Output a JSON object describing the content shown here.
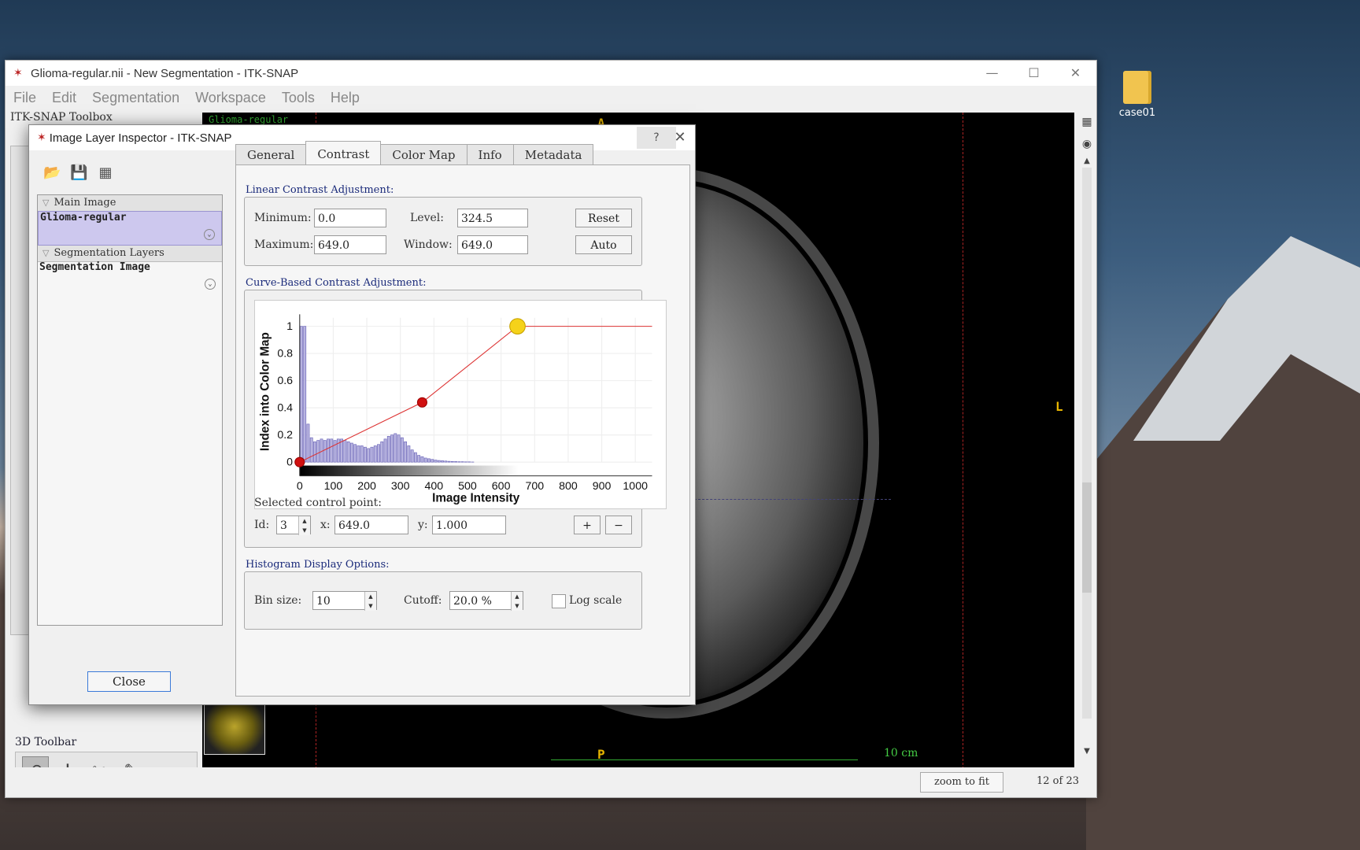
{
  "desktop": {
    "folder_label": "case01"
  },
  "window": {
    "title": "Glioma-regular.nii - New Segmentation - ITK-SNAP",
    "controls": [
      "—",
      "☐",
      "✕"
    ]
  },
  "menu": [
    "File",
    "Edit",
    "Segmentation",
    "Workspace",
    "Tools",
    "Help"
  ],
  "toolbox": {
    "title": "ITK-SNAP Toolbox",
    "toolbar3d_label": "3D Toolbar"
  },
  "viewer": {
    "layer_label": "Glioma-regular",
    "orient_top": "A",
    "orient_bottom": "P",
    "orient_right": "L",
    "scale_label": "10 cm",
    "zoom_button": "zoom to fit",
    "slice_label": "12 of 23"
  },
  "dialog": {
    "title": "Image Layer Inspector - ITK-SNAP",
    "help": "?",
    "close_x": "✕",
    "layers": {
      "main_header": "Main Image",
      "main_item": "Glioma-regular",
      "seg_header": "Segmentation Layers",
      "seg_item": "Segmentation Image"
    },
    "close_button": "Close",
    "tabs": [
      "General",
      "Contrast",
      "Color Map",
      "Info",
      "Metadata"
    ],
    "active_tab": "Contrast",
    "linear": {
      "section": "Linear Contrast Adjustment:",
      "min_label": "Minimum:",
      "min_value": "0.0",
      "max_label": "Maximum:",
      "max_value": "649.0",
      "level_label": "Level:",
      "level_value": "324.5",
      "window_label": "Window:",
      "window_value": "649.0",
      "reset": "Reset",
      "auto": "Auto"
    },
    "curve": {
      "section": "Curve-Based Contrast Adjustment:",
      "selected_label": "Selected control point:",
      "id_label": "Id:",
      "id_value": "3",
      "x_label": "x:",
      "x_value": "649.0",
      "y_label": "y:",
      "y_value": "1.000",
      "plus": "+",
      "minus": "−"
    },
    "histogram": {
      "section": "Histogram Display Options:",
      "bin_label": "Bin size:",
      "bin_value": "10",
      "cutoff_label": "Cutoff:",
      "cutoff_value": "20.0 %",
      "log_label": "Log scale",
      "log_checked": false
    }
  },
  "chart_data": {
    "type": "line",
    "xlabel": "Image Intensity",
    "ylabel": "Index into Color Map",
    "xlim": [
      0,
      1050
    ],
    "ylim": [
      0,
      1
    ],
    "xticks": [
      0,
      100,
      200,
      300,
      400,
      500,
      600,
      700,
      800,
      900,
      1000
    ],
    "yticks": [
      0,
      0.2,
      0.4,
      0.6,
      0.8,
      1
    ],
    "curve": {
      "x": [
        0,
        365,
        649,
        1050
      ],
      "y": [
        0,
        0.44,
        1,
        1
      ]
    },
    "control_points": [
      {
        "x": 0,
        "y": 0,
        "color": "#d01010"
      },
      {
        "x": 365,
        "y": 0.44,
        "color": "#d01010"
      },
      {
        "x": 649,
        "y": 1,
        "color": "#f5d21a"
      }
    ],
    "histogram": {
      "bin_size": 10,
      "counts": [
        1.0,
        1.0,
        0.28,
        0.18,
        0.15,
        0.16,
        0.17,
        0.16,
        0.17,
        0.17,
        0.16,
        0.17,
        0.17,
        0.16,
        0.15,
        0.14,
        0.13,
        0.12,
        0.12,
        0.11,
        0.1,
        0.11,
        0.12,
        0.13,
        0.15,
        0.17,
        0.19,
        0.2,
        0.21,
        0.2,
        0.18,
        0.15,
        0.12,
        0.09,
        0.07,
        0.05,
        0.04,
        0.03,
        0.025,
        0.02,
        0.015,
        0.012,
        0.01,
        0.008,
        0.006,
        0.005,
        0.004,
        0.003,
        0.003,
        0.002,
        0.002,
        0.001
      ]
    },
    "colors": {
      "curve": "#d33",
      "bars": "#b8b4e0",
      "bar_edge": "#6a64b8"
    }
  }
}
